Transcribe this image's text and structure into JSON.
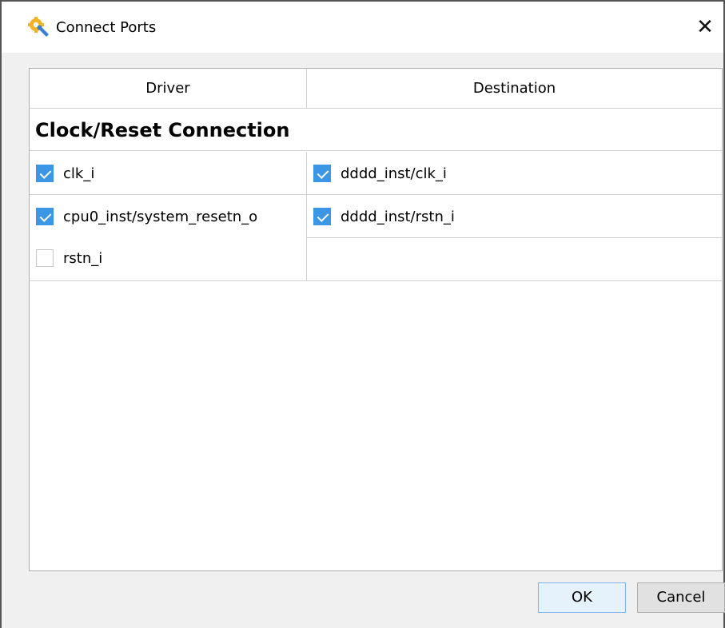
{
  "window": {
    "title": "Connect Ports",
    "icon": "gear-wrench-icon",
    "close_glyph": "✕"
  },
  "table": {
    "headers": {
      "driver": "Driver",
      "destination": "Destination"
    },
    "section_title": "Clock/Reset Connection",
    "rows": [
      {
        "drivers": [
          {
            "label": "clk_i",
            "checked": true
          }
        ],
        "destinations": [
          {
            "label": "dddd_inst/clk_i",
            "checked": true
          }
        ]
      },
      {
        "drivers": [
          {
            "label": "cpu0_inst/system_resetn_o",
            "checked": true
          },
          {
            "label": "rstn_i",
            "checked": false
          }
        ],
        "destinations": [
          {
            "label": "dddd_inst/rstn_i",
            "checked": true
          }
        ]
      }
    ]
  },
  "buttons": {
    "ok": "OK",
    "cancel": "Cancel"
  },
  "colors": {
    "accent": "#3c96e6",
    "panel_bg": "#ffffff",
    "window_bg": "#f0f0f0"
  }
}
